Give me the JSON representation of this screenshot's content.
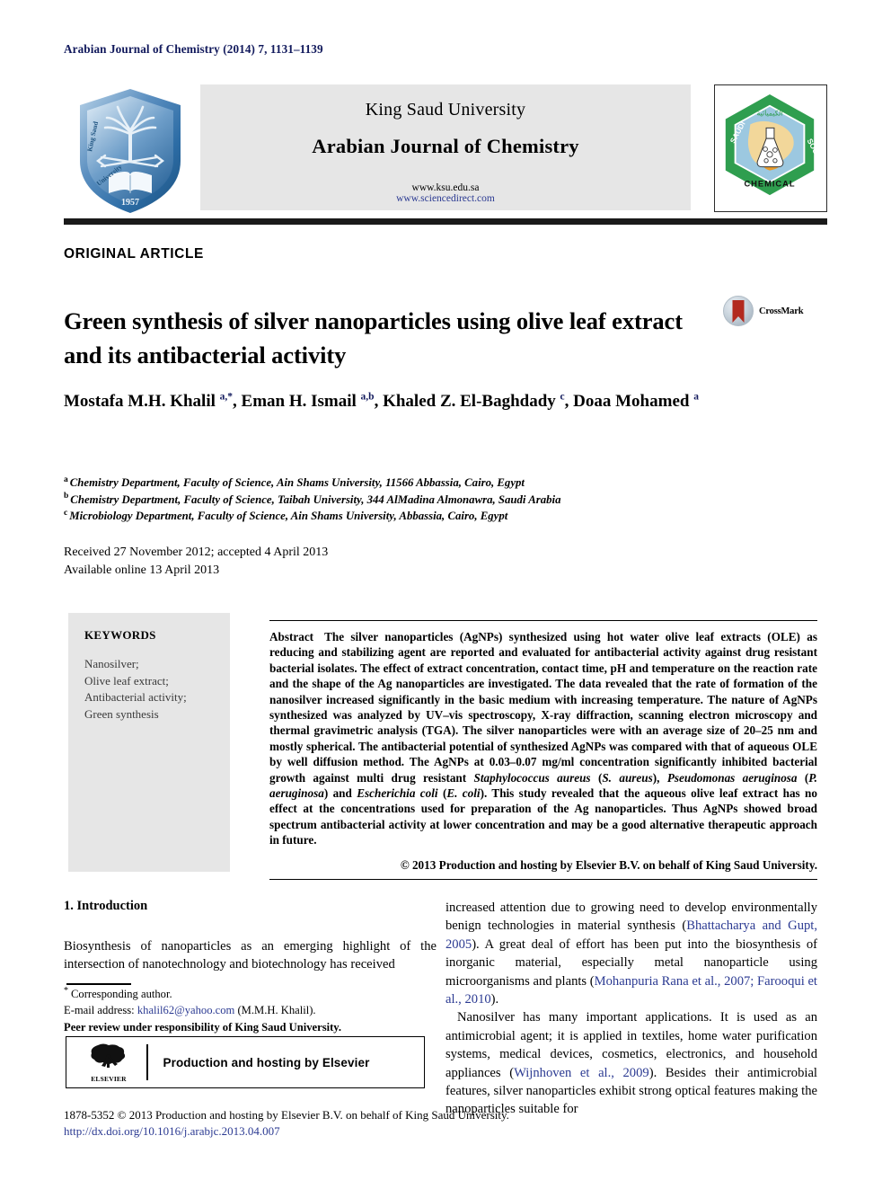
{
  "running_head": "Arabian Journal of Chemistry (2014) 7, 1131–1139",
  "masthead": {
    "university": "King Saud University",
    "journal": "Arabian Journal of Chemistry",
    "url_ksu": "www.ksu.edu.sa",
    "url_sciencedirect": "www.sciencedirect.com",
    "left_logo": "king-saud-university-shield-logo",
    "left_logo_text_en": "King Saud University",
    "left_logo_year": "1957",
    "right_logo": "saudi-chemical-society-hexagon-logo",
    "right_logo_words": [
      "SAUDI",
      "SOCIETY",
      "CHEMICAL"
    ]
  },
  "article_type": "ORIGINAL ARTICLE",
  "title": "Green synthesis of silver nanoparticles using olive leaf extract and its antibacterial activity",
  "crossmark": {
    "label": "CrossMark",
    "icon": "crossmark-badge-icon"
  },
  "authors_html": "Mostafa M.H. Khalil <sup>a,*</sup>, Eman H. Ismail <sup>a,b</sup>, Khaled Z. El-Baghdady <sup>c</sup>, Doaa Mohamed <sup>a</sup>",
  "affiliations": [
    {
      "mark": "a",
      "text": "Chemistry Department, Faculty of Science, Ain Shams University, 11566 Abbassia, Cairo, Egypt"
    },
    {
      "mark": "b",
      "text": "Chemistry Department, Faculty of Science, Taibah University, 344 AlMadina Almonawra, Saudi Arabia"
    },
    {
      "mark": "c",
      "text": "Microbiology Department, Faculty of Science, Ain Shams University, Abbassia, Cairo, Egypt"
    }
  ],
  "dates": {
    "received": "Received 27 November 2012; accepted 4 April 2013",
    "available": "Available online 13 April 2013"
  },
  "keywords": {
    "heading": "KEYWORDS",
    "items": [
      "Nanosilver;",
      "Olive leaf extract;",
      "Antibacterial activity;",
      "Green synthesis"
    ]
  },
  "abstract": {
    "label": "Abstract",
    "body_html": "The silver nanoparticles (AgNPs) synthesized using hot water olive leaf extracts (OLE) as reducing and stabilizing agent are reported and evaluated for antibacterial activity against drug resistant bacterial isolates. The effect of extract concentration, contact time, pH and temperature on the reaction rate and the shape of the Ag nanoparticles are investigated. The data revealed that the rate of formation of the nanosilver increased significantly in the basic medium with increasing temperature. The nature of AgNPs synthesized was analyzed by UV–vis spectroscopy, X-ray diffraction, scanning electron microscopy and thermal gravimetric analysis (TGA). The silver nanoparticles were with an average size of 20–25 nm and mostly spherical. The antibacterial potential of synthesized AgNPs was compared with that of aqueous OLE by well diffusion method. The AgNPs at 0.03–0.07 mg/ml concentration significantly inhibited bacterial growth against multi drug resistant <i>Staphylococcus aureus</i> (<i>S. aureus</i>), <i>Pseudomonas aeruginosa</i> (<i>P. aeruginosa</i>) and <i>Escherichia coli</i> (<i>E. coli</i>). This study revealed that the aqueous olive leaf extract has no effect at the concentrations used for preparation of the Ag nanoparticles. Thus AgNPs showed broad spectrum antibacterial activity at lower concentration and may be a good alternative therapeutic approach in future.",
    "copyright": "© 2013 Production and hosting by Elsevier B.V. on behalf of King Saud University."
  },
  "body": {
    "section_heading": "1. Introduction",
    "left_paragraph_html": "Biosynthesis of nanoparticles as an emerging highlight of the intersection of nanotechnology and biotechnology has received",
    "right_paragraph_1_html": "increased attention due to growing need to develop environmentally benign technologies in material synthesis (<span class=\"ref\">Bhattacharya and Gupt, 2005</span>). A great deal of effort has been put into the biosynthesis of inorganic material, especially metal nanoparticle using microorganisms and plants (<span class=\"ref\">Mohanpuria Rana et al., 2007; Farooqui et al., 2010</span>).",
    "right_paragraph_2_html": "Nanosilver has many important applications. It is used as an antimicrobial agent; it is applied in textiles, home water purification systems, medical devices, cosmetics, electronics, and household appliances (<span class=\"ref\">Wijnhoven et al., 2009</span>). Besides their antimicrobial features, silver nanoparticles exhibit strong optical features making the nanoparticles suitable for"
  },
  "footnotes": {
    "corresponding": "Corresponding author.",
    "email_label": "E-mail address:",
    "email": "khalil62@yahoo.com",
    "email_owner": "(M.M.H. Khalil).",
    "peer_review": "Peer review under responsibility of King Saud University."
  },
  "elsevier_box": {
    "logo": "elsevier-tree-logo",
    "logo_word": "ELSEVIER",
    "text": "Production and hosting by Elsevier"
  },
  "footer": {
    "issn_line": "1878-5352 © 2013 Production and hosting by Elsevier B.V. on behalf of King Saud University.",
    "doi": "http://dx.doi.org/10.1016/j.arabjc.2013.04.007"
  },
  "colors": {
    "link": "#2b3a92",
    "running_head": "#11195c",
    "masthead_bg": "#e6e6e6",
    "rule": "#1a1a1a"
  }
}
